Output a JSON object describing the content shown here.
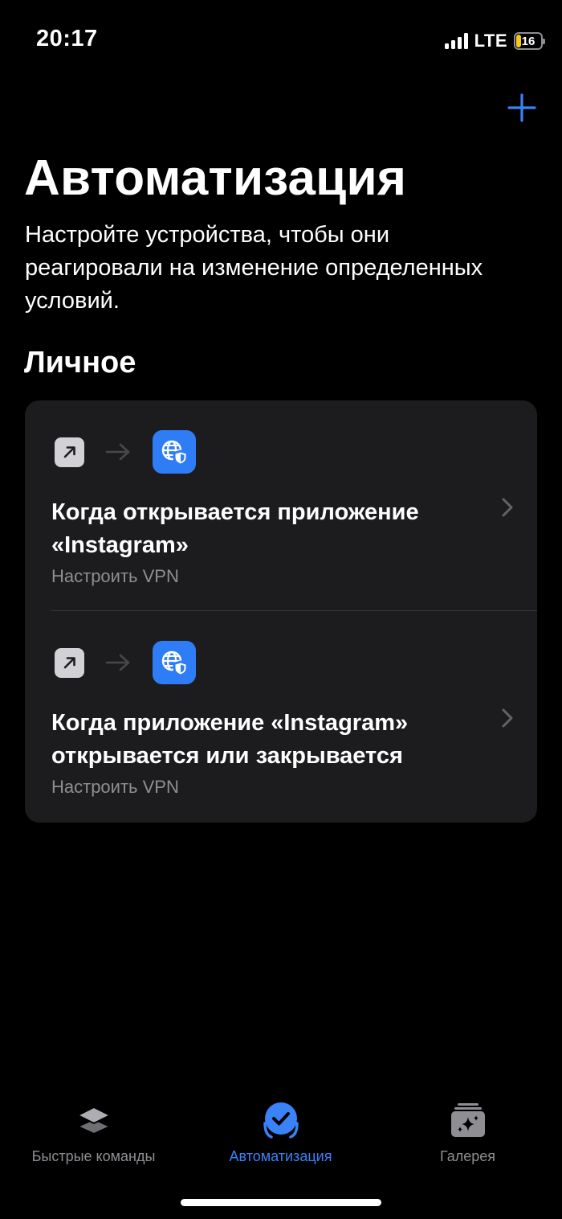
{
  "status_bar": {
    "time": "20:17",
    "network": "LTE",
    "battery_level": "16",
    "battery_color": "#f7c81e"
  },
  "header": {
    "add_icon": "plus-icon",
    "title": "Автоматизация",
    "subtitle": "Настройте устройства, чтобы они реагировали на изменение определенных условий."
  },
  "section": {
    "title": "Личное"
  },
  "automations": [
    {
      "trigger_icon": "app-open-arrow-icon",
      "action_icon": "vpn-globe-shield-icon",
      "title": "Когда открывается приложение «Instagram»",
      "subtitle": "Настроить VPN"
    },
    {
      "trigger_icon": "app-open-arrow-icon",
      "action_icon": "vpn-globe-shield-icon",
      "title": "Когда приложение «Instagram» открывается или закрывается",
      "subtitle": "Настроить VPN"
    }
  ],
  "tab_bar": {
    "tabs": [
      {
        "label": "Быстрые команды",
        "icon": "layers-icon",
        "active": false
      },
      {
        "label": "Автоматизация",
        "icon": "checkmark-clock-icon",
        "active": true
      },
      {
        "label": "Галерея",
        "icon": "sparkle-stack-icon",
        "active": false
      }
    ]
  },
  "colors": {
    "accent": "#3a82f7",
    "background": "#000000",
    "card": "#1c1c1e",
    "secondary_text": "#8e8e93"
  }
}
